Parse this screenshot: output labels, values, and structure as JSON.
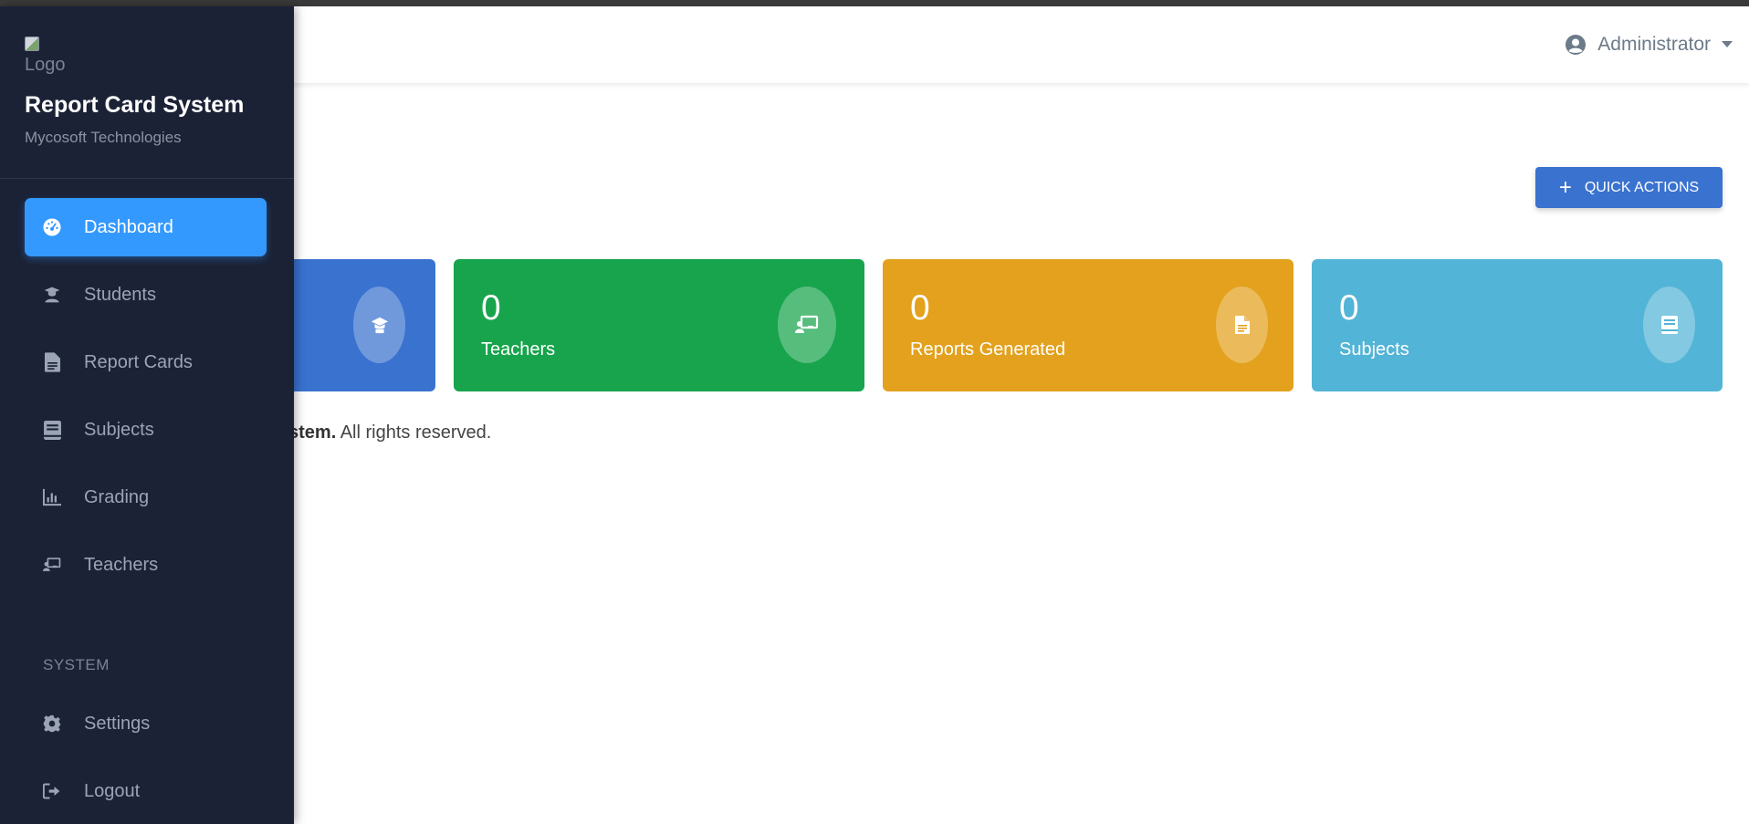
{
  "topbar": {
    "user_name": "Administrator"
  },
  "quick_actions": {
    "label": "QUICK ACTIONS",
    "plus": "+"
  },
  "cards": {
    "students": {
      "value": "",
      "label": ""
    },
    "teachers": {
      "value": "0",
      "label": "Teachers"
    },
    "reports": {
      "value": "0",
      "label": "Reports Generated"
    },
    "subjects": {
      "value": "0",
      "label": "Subjects"
    }
  },
  "footer": {
    "bold": "stem.",
    "rest": " All rights reserved."
  },
  "sidebar": {
    "logo_alt": "Logo",
    "title": "Report Card System",
    "subtitle": "Mycosoft Technologies",
    "items": [
      {
        "label": "Dashboard",
        "icon": "dashboard-icon"
      },
      {
        "label": "Students",
        "icon": "student-icon"
      },
      {
        "label": "Report Cards",
        "icon": "file-icon"
      },
      {
        "label": "Subjects",
        "icon": "book-icon"
      },
      {
        "label": "Grading",
        "icon": "chart-icon"
      },
      {
        "label": "Teachers",
        "icon": "teacher-icon"
      }
    ],
    "section_system": "SYSTEM",
    "system_items": [
      {
        "label": "Settings",
        "icon": "gear-icon"
      },
      {
        "label": "Logout",
        "icon": "logout-icon"
      }
    ]
  },
  "colors": {
    "sidebar_bg": "#1b2236",
    "active": "#3399ff",
    "primary": "#3a72cf",
    "success": "#17a44c",
    "warning": "#e3a11d",
    "info": "#52b4d6"
  }
}
